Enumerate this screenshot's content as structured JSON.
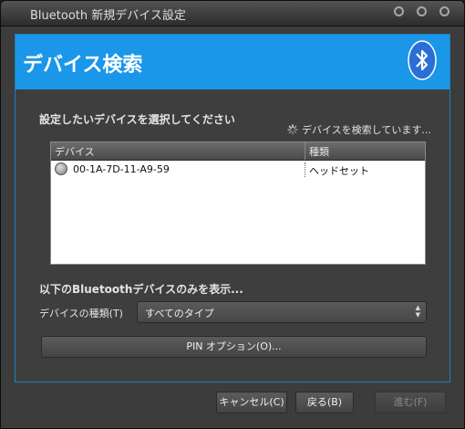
{
  "window": {
    "title": "Bluetooth 新規デバイス設定"
  },
  "header": {
    "title": "デバイス検索",
    "icon": "bluetooth-icon",
    "accent": "#1a97e8"
  },
  "selection": {
    "prompt": "設定したいデバイスを選択してください",
    "status": "デバイスを検索しています..."
  },
  "device_list": {
    "columns": [
      "デバイス",
      "種類"
    ],
    "rows": [
      {
        "icon": "headset-icon",
        "device": "00-1A-7D-11-A9-59",
        "type": "ヘッドセット"
      }
    ]
  },
  "filter": {
    "heading": "以下のBluetoothデバイスのみを表示...",
    "type_label": "デバイスの種類(T)",
    "type_value": "すべてのタイプ"
  },
  "pin_button": "PIN オプション(O)...",
  "footer": {
    "cancel": "キャンセル(C)",
    "back": "戻る(B)",
    "next": "進む(F)"
  }
}
